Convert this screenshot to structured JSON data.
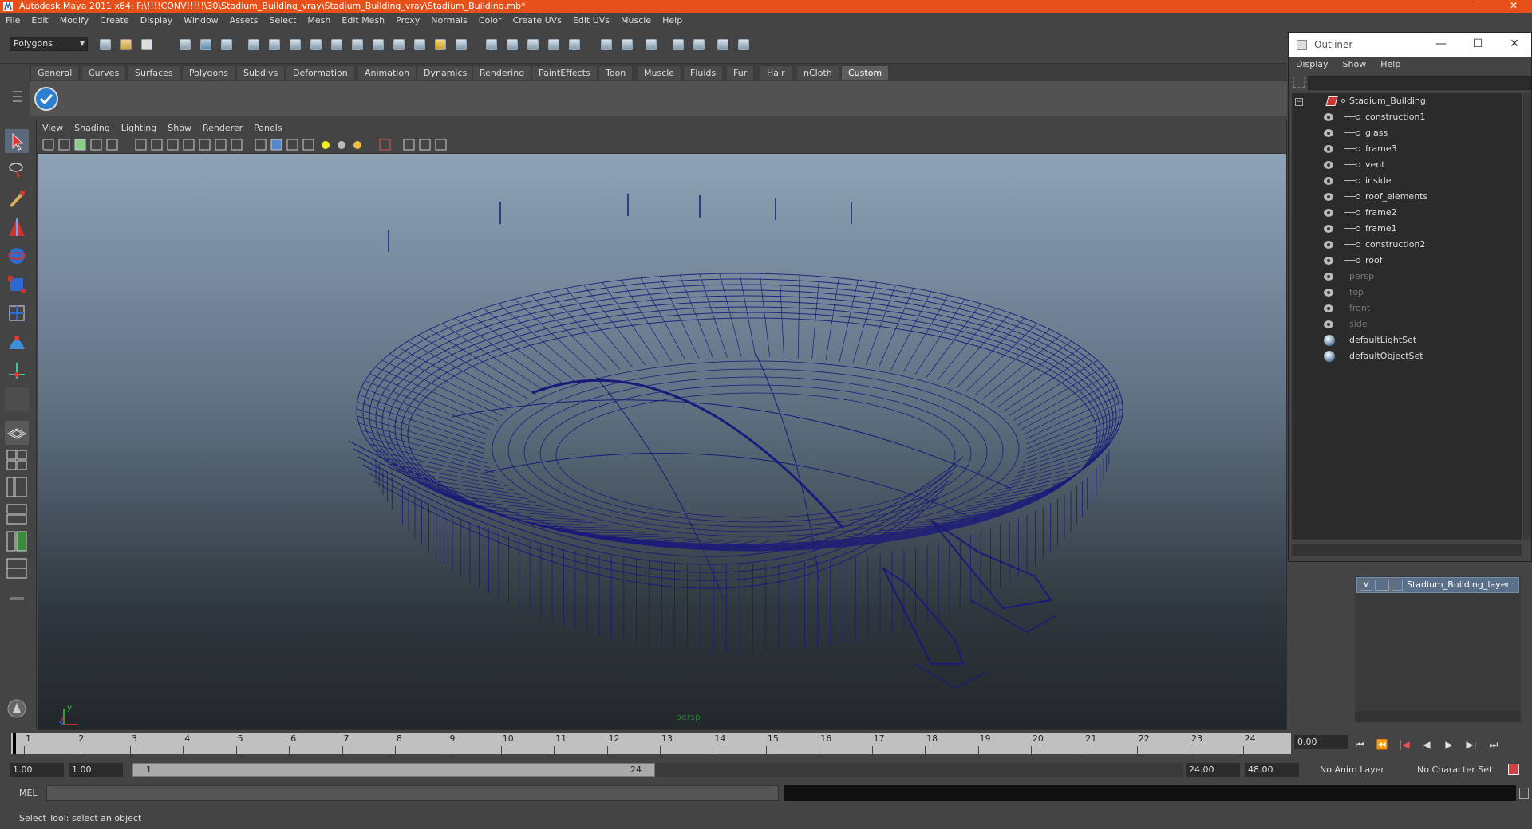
{
  "window": {
    "title": "Autodesk Maya 2011 x64: F:\\!!!!CONV!!!!!\\30\\Stadium_Building_vray\\Stadium_Building_vray\\Stadium_Building.mb*",
    "controls": [
      "—",
      "☐",
      "✕"
    ]
  },
  "menubar": [
    "File",
    "Edit",
    "Modify",
    "Create",
    "Display",
    "Window",
    "Assets",
    "Select",
    "Mesh",
    "Edit Mesh",
    "Proxy",
    "Normals",
    "Color",
    "Create UVs",
    "Edit UVs",
    "Muscle",
    "Help"
  ],
  "statusline": {
    "mode_dropdown": "Polygons"
  },
  "shelf": {
    "tabs": [
      "General",
      "Curves",
      "Surfaces",
      "Polygons",
      "Subdivs",
      "Deformation",
      "Animation",
      "Dynamics",
      "Rendering",
      "PaintEffects",
      "Toon",
      "Muscle",
      "Fluids",
      "Fur",
      "Hair",
      "nCloth",
      "Custom"
    ],
    "active_tab": "Custom"
  },
  "viewport": {
    "menu": [
      "View",
      "Shading",
      "Lighting",
      "Show",
      "Renderer",
      "Panels"
    ],
    "camera_label": "persp",
    "axis_y": "y",
    "axis_x": "x",
    "wire_color": "#1a1a7a"
  },
  "outliner": {
    "title": "Outliner",
    "controls": [
      "—",
      "☐",
      "✕"
    ],
    "menu": [
      "Display",
      "Show",
      "Help"
    ],
    "items": [
      {
        "label": "Stadium_Building",
        "dim": false
      },
      {
        "label": "construction1",
        "dim": false
      },
      {
        "label": "glass",
        "dim": false
      },
      {
        "label": "frame3",
        "dim": false
      },
      {
        "label": "vent",
        "dim": false
      },
      {
        "label": "inside",
        "dim": false
      },
      {
        "label": "roof_elements",
        "dim": false
      },
      {
        "label": "frame2",
        "dim": false
      },
      {
        "label": "frame1",
        "dim": false
      },
      {
        "label": "construction2",
        "dim": false
      },
      {
        "label": "roof",
        "dim": false
      },
      {
        "label": "persp",
        "dim": true
      },
      {
        "label": "top",
        "dim": true
      },
      {
        "label": "front",
        "dim": true
      },
      {
        "label": "side",
        "dim": true
      },
      {
        "label": "defaultLightSet",
        "dim": false
      },
      {
        "label": "defaultObjectSet",
        "dim": false
      }
    ]
  },
  "layers": {
    "row": {
      "visible": "V",
      "name": "Stadium_Building_layer"
    }
  },
  "timeslider": {
    "ticks": [
      "1",
      "2",
      "3",
      "4",
      "5",
      "6",
      "7",
      "8",
      "9",
      "10",
      "11",
      "12",
      "13",
      "14",
      "15",
      "16",
      "17",
      "18",
      "19",
      "20",
      "21",
      "22",
      "23",
      "24"
    ],
    "current_time": "0.00"
  },
  "playback": [
    "⏮",
    "⏪",
    "|◀",
    "◀",
    "▶",
    "▶|",
    "⏭"
  ],
  "range": {
    "start": "1.00",
    "start2": "1.00",
    "handle_start": "1",
    "handle_end": "24",
    "end": "24.00",
    "end2": "48.00",
    "anim_layer": "No Anim Layer",
    "char_set": "No Character Set"
  },
  "cmdline": {
    "label": "MEL"
  },
  "helpline": {
    "text": "Select Tool: select an object"
  }
}
